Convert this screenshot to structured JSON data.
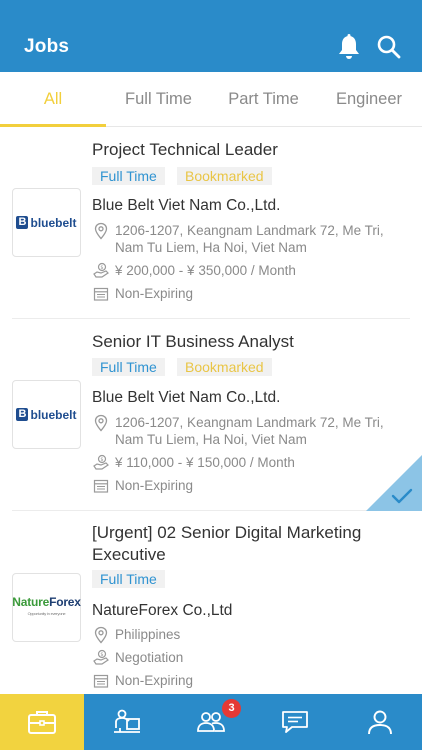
{
  "header": {
    "title": "Jobs",
    "icons": [
      "bell-icon",
      "search-icon"
    ]
  },
  "tabs": [
    {
      "label": "All",
      "active": true
    },
    {
      "label": "Full Time",
      "active": false
    },
    {
      "label": "Part Time",
      "active": false
    },
    {
      "label": "Engineer",
      "active": false
    }
  ],
  "jobs": [
    {
      "title": "Project Technical Leader",
      "badges": [
        "Full Time",
        "Bookmarked"
      ],
      "company": "Blue Belt Viet Nam Co.,Ltd.",
      "address": "1206-1207, Keangnam Landmark 72, Me Tri, Nam Tu Liem, Ha Noi, Viet Nam",
      "salary": "¥ 200,000 - ¥ 350,000 / Month",
      "expiry": "Non-Expiring",
      "logo_text": "bluebelt"
    },
    {
      "title": "Senior IT Business Analyst",
      "badges": [
        "Full Time",
        "Bookmarked"
      ],
      "company": "Blue Belt Viet Nam Co.,Ltd.",
      "address": "1206-1207, Keangnam Landmark 72, Me Tri, Nam Tu Liem, Ha Noi, Viet Nam",
      "salary": "¥ 110,000 - ¥ 150,000 / Month",
      "expiry": "Non-Expiring",
      "logo_text": "bluebelt",
      "applied": true
    },
    {
      "title": "[Urgent] 02 Senior Digital Marketing Executive",
      "badges": [
        "Full Time"
      ],
      "company": "NatureForex Co.,Ltd",
      "address": "Philippines",
      "salary": "Negotiation",
      "expiry": "Non-Expiring",
      "logo_text": {
        "part1": "Nature",
        "part2": "Forex",
        "tagline": "Opportunity in everyone"
      }
    }
  ],
  "bottom_nav": [
    {
      "icon": "briefcase-icon",
      "active": true
    },
    {
      "icon": "presenter-icon",
      "active": false
    },
    {
      "icon": "people-icon",
      "active": false,
      "badge": "3"
    },
    {
      "icon": "chat-icon",
      "active": false
    },
    {
      "icon": "profile-icon",
      "active": false
    }
  ],
  "colors": {
    "primary": "#2a8bc9",
    "accent": "#f2cf3c",
    "badge_blue": "#2f93d1",
    "badge_yellow": "#e9c545",
    "notification": "#e53935"
  }
}
